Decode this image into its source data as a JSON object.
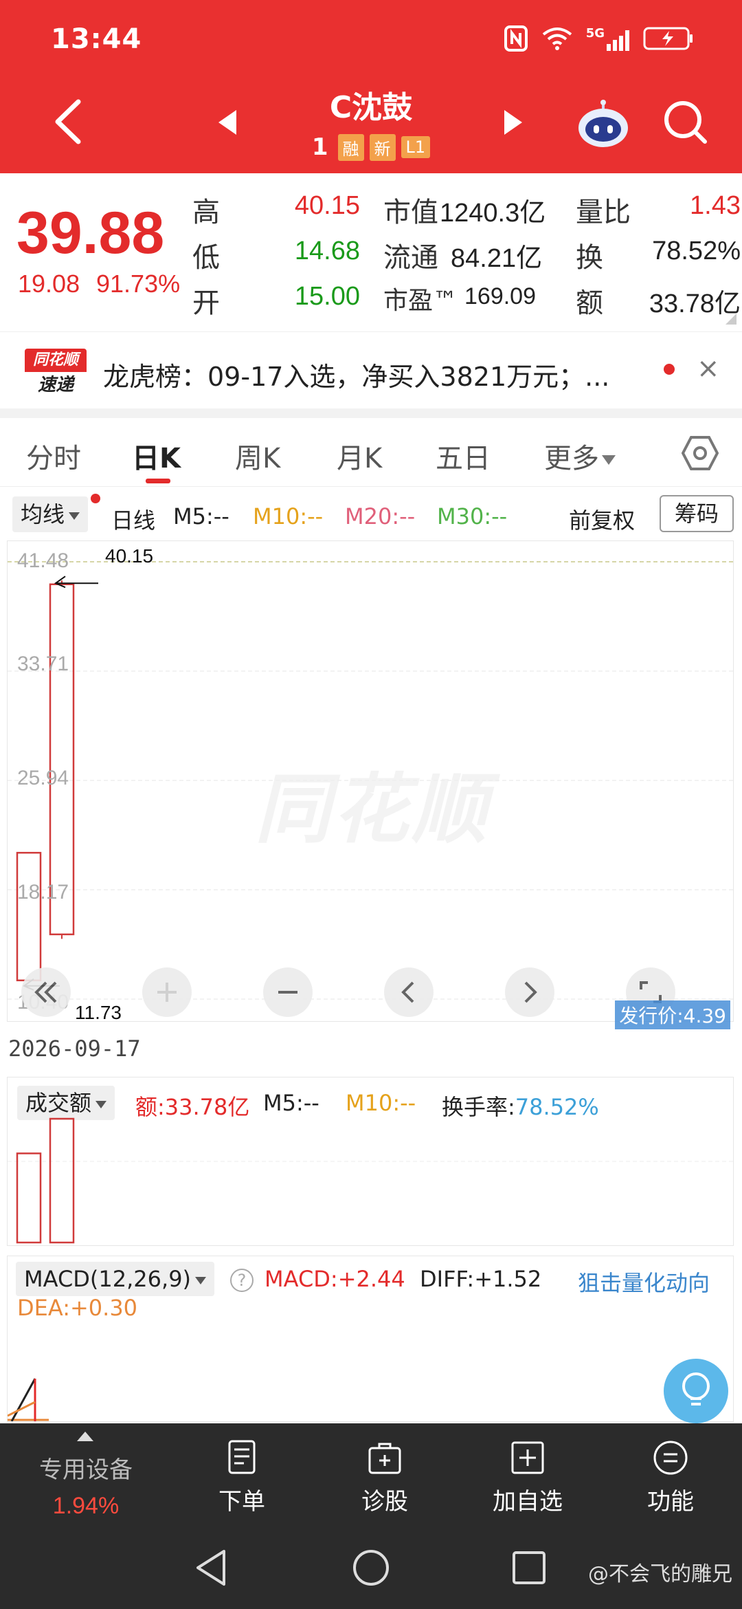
{
  "status_bar": {
    "time": "13:44",
    "network": "5G"
  },
  "header": {
    "title": "C沈鼓",
    "sub_number": "1",
    "tags": [
      "融",
      "新",
      "L1"
    ]
  },
  "quote": {
    "price": "39.88",
    "change": "19.08",
    "change_pct": "91.73%",
    "high_label": "高",
    "high_value": "40.15",
    "low_label": "低",
    "low_value": "14.68",
    "open_label": "开",
    "open_value": "15.00",
    "mktcap_label": "市值",
    "mktcap_value": "1240.3亿",
    "float_label": "流通",
    "float_value": "84.21亿",
    "pe_label": "市盈™",
    "pe_value": "169.09",
    "volratio_label": "量比",
    "volratio_value": "1.43",
    "turnover_label": "换",
    "turnover_value": "78.52%",
    "amount_label": "额",
    "amount_value": "33.78亿"
  },
  "ticker": {
    "logo_line1": "同花顺",
    "logo_line2": "速递",
    "text": "龙虎榜：09-17入选，净买入3821万元；...",
    "close": "×"
  },
  "tabs": [
    {
      "label": "分时"
    },
    {
      "label": "日K"
    },
    {
      "label": "周K"
    },
    {
      "label": "月K"
    },
    {
      "label": "五日"
    },
    {
      "label": "更多"
    }
  ],
  "indicators": {
    "ma_button": "均线",
    "period": "日线",
    "m5": "M5:--",
    "m10": "M10:--",
    "m20": "M20:--",
    "m30": "M30:--",
    "adjust": "前复权",
    "chips": "筹码",
    "colors": {
      "m5": "#222222",
      "m10": "#e5a21b",
      "m20": "#e0607a",
      "m30": "#52b34a"
    }
  },
  "kline": {
    "watermark": "同花顺",
    "y_ticks": [
      "41.48",
      "33.71",
      "25.94",
      "18.17",
      "10.40"
    ],
    "high_annotation": "40.15",
    "low_annotation": "11.73",
    "issue_price": "发行价:4.39"
  },
  "chart_data": {
    "type": "candlestick",
    "y_ticks": [
      41.48,
      33.71,
      25.94,
      18.17,
      10.4
    ],
    "ylim": [
      10.4,
      41.48
    ],
    "candles": [
      {
        "open": 20.8,
        "close": 11.73,
        "high": 20.8,
        "low": 11.73,
        "color": "#d03a3a"
      },
      {
        "open": 15.0,
        "close": 39.88,
        "high": 40.15,
        "low": 14.68,
        "color": "#d03a3a"
      }
    ],
    "volume": [
      0.72,
      1.0
    ],
    "high_marker": 40.15,
    "low_marker": 11.73
  },
  "date": "2026-09-17",
  "volume": {
    "button": "成交额",
    "amount": "额:33.78亿",
    "m5": "M5:--",
    "m10": "M10:--",
    "turnover_label": "换手率:",
    "turnover_value": "78.52%"
  },
  "macd": {
    "button": "MACD(12,26,9)",
    "help": "?",
    "macd": "MACD:+2.44",
    "diff": "DIFF:+1.52",
    "dea": "DEA:+0.30",
    "promo": "狙击量化动向"
  },
  "toolbar": {
    "device_label": "专用设备",
    "device_value": "1.94%",
    "order": "下单",
    "diagnose": "诊股",
    "watchlist": "加自选",
    "functions": "功能"
  },
  "credit": "@不会飞的雕兄"
}
